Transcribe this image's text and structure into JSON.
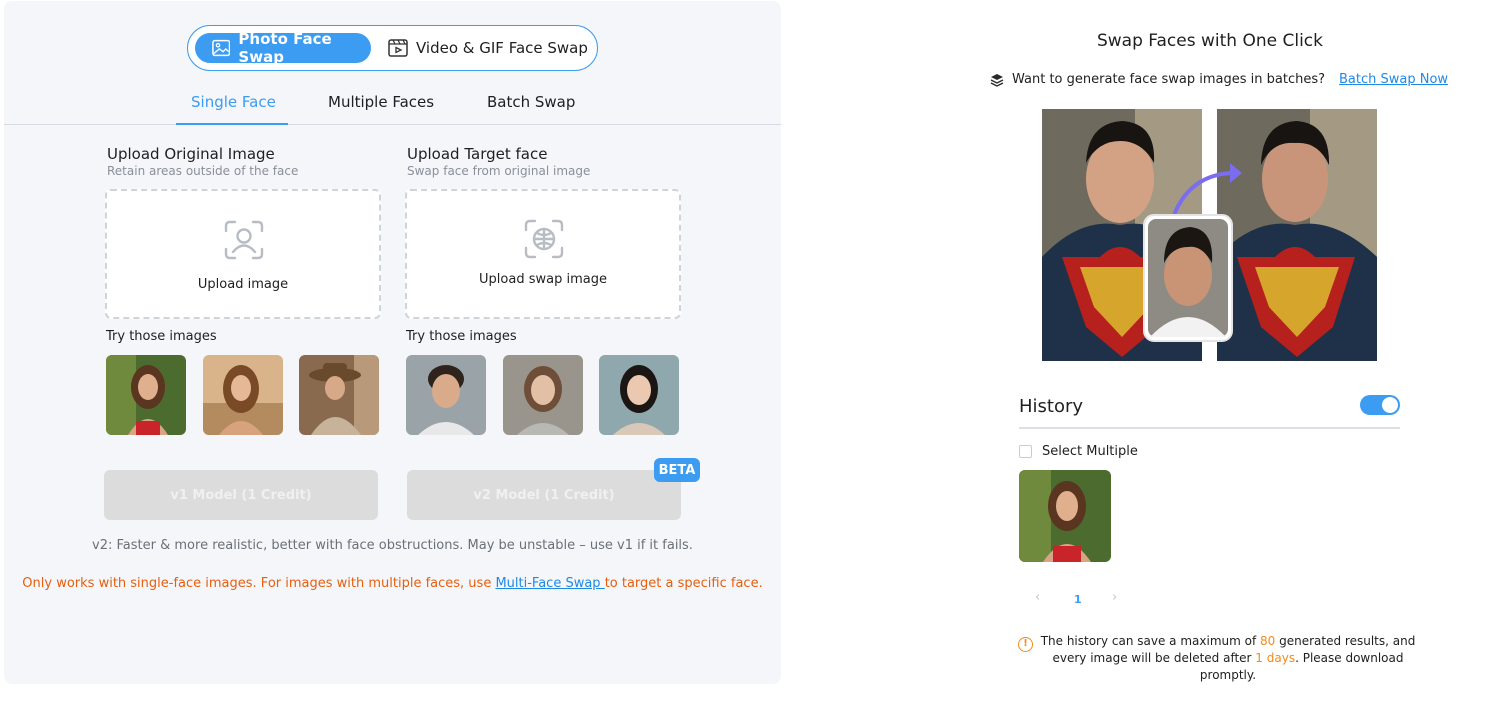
{
  "mode_switch": {
    "photo_label": "Photo Face Swap",
    "video_label": "Video & GIF Face Swap"
  },
  "tabs": [
    {
      "label": "Single Face",
      "active": true
    },
    {
      "label": "Multiple Faces",
      "active": false
    },
    {
      "label": "Batch Swap",
      "active": false
    }
  ],
  "original_upload": {
    "title": "Upload Original Image",
    "subtitle": "Retain areas outside of the face",
    "button_label": "Upload image",
    "try_label": "Try those images"
  },
  "target_upload": {
    "title": "Upload Target face",
    "subtitle": "Swap face from original image",
    "button_label": "Upload swap image",
    "try_label": "Try those images"
  },
  "models": {
    "v1_label": "v1 Model (1 Credit)",
    "v2_label": "v2 Model (1 Credit)",
    "beta_badge": "BETA"
  },
  "notes": {
    "v2_note": "v2: Faster & more realistic, better with face obstructions. May be unstable – use v1 if it fails.",
    "warn_prefix": "Only works with single-face images. For images with multiple faces, use ",
    "warn_link": "Multi-Face Swap ",
    "warn_suffix": "to target a specific face."
  },
  "right": {
    "title": "Swap Faces with One Click",
    "batch_question": "Want to generate face swap images in batches?",
    "batch_link": "Batch Swap Now"
  },
  "history": {
    "title": "History",
    "toggle_on": true,
    "select_multiple": "Select Multiple",
    "prev": "‹",
    "page": "1",
    "next": "›",
    "retention_1": "The history can save a maximum of ",
    "max_count": "80",
    "retention_2": " generated results, and every image will be deleted after ",
    "retention_days": "1 days",
    "retention_3": ". Please download promptly."
  },
  "colors": {
    "accent": "#3b9cf1",
    "warning": "#e65f0f",
    "highlight": "#f08c1a",
    "link": "#1f8ae6"
  }
}
